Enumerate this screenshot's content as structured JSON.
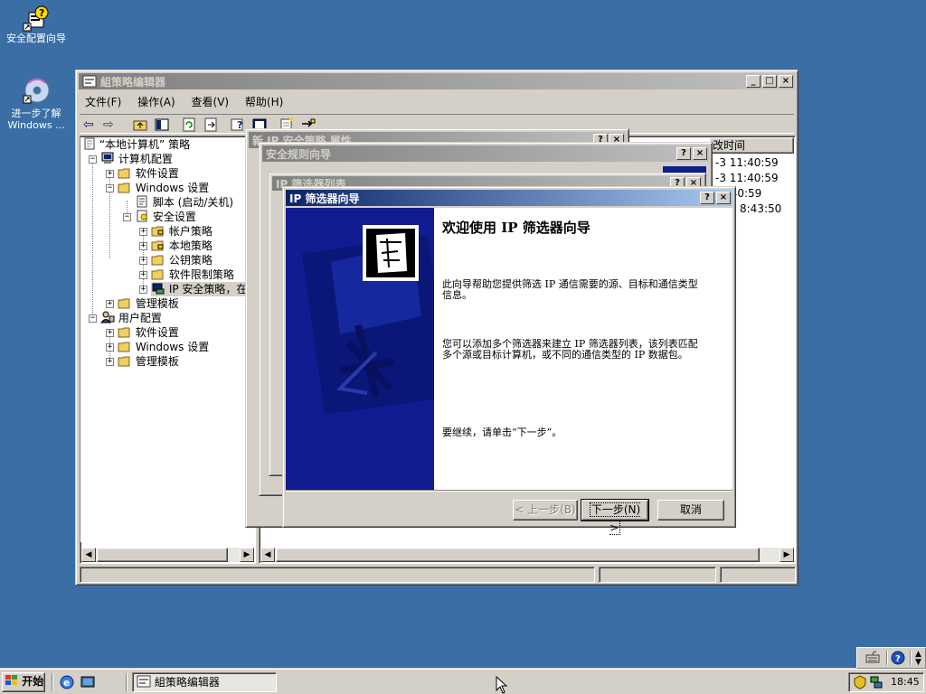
{
  "desktop": {
    "icons": [
      {
        "label": "安全配置向导"
      },
      {
        "label_line1": "进一步了解",
        "label_line2": "Windows ..."
      }
    ]
  },
  "gpedit": {
    "title": "組策略编辑器",
    "menu": [
      "文件(F)",
      "操作(A)",
      "查看(V)",
      "帮助(H)"
    ],
    "tree": [
      "“本地计算机” 策略",
      "计算机配置",
      "软件设置",
      "Windows 设置",
      "脚本 (启动/关机)",
      "安全设置",
      "帐户策略",
      "本地策略",
      "公钥策略",
      "软件限制策略",
      "IP 安全策略，在",
      "管理模板",
      "用户配置",
      "软件设置",
      "Windows 设置",
      "管理模板"
    ],
    "list_header": "改时间",
    "list_rows": [
      "-3 11:40:59",
      "-3 11:40:59",
      "1:40:59",
      "8:43:50"
    ]
  },
  "bg_windows": {
    "props_title": "新 IP 安全策略 属性",
    "rule_wizard_title": "安全规则向导",
    "filter_list_title": "IP 筛选器列表"
  },
  "wizard": {
    "title": "IP 筛选器向导",
    "heading": "欢迎使用 IP 筛选器向导",
    "para1": "此向导帮助您提供筛选 IP 通信需要的源、目标和通信类型信息。",
    "para2": "您可以添加多个筛选器来建立 IP 筛选器列表，该列表匹配多个源或目标计算机，或不同的通信类型的 IP 数据包。",
    "para3": "要继续，请单击“下一步”。",
    "back_label": "< 上一步(B)",
    "next_label": "下一步(N) >",
    "cancel_label": "取消"
  },
  "taskbar": {
    "start_label": "开始",
    "task_label": "組策略编辑器",
    "clock": "18:45"
  },
  "colors": {
    "desktop": "#3a6ea5",
    "title_active": "#0a246a",
    "wizard_side": "#0f1e8c"
  }
}
